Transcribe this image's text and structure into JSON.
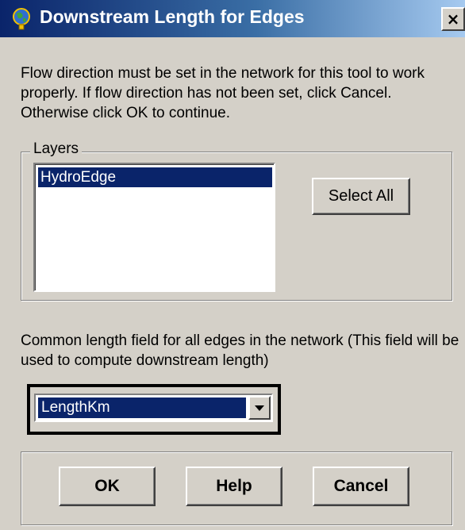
{
  "window": {
    "title": "Downstream Length for Edges",
    "close_glyph": "×"
  },
  "message": "Flow direction must be set in the network for this tool to work properly. If flow direction has not been set, click Cancel. Otherwise click OK to continue.",
  "layers": {
    "label": "Layers",
    "items": [
      "HydroEdge"
    ],
    "select_all_label": "Select All"
  },
  "length_field": {
    "label": "Common length field for all edges in the network (This field will be used to compute downstream length)",
    "selected": "LengthKm"
  },
  "buttons": {
    "ok": "OK",
    "help": "Help",
    "cancel": "Cancel"
  },
  "colors": {
    "title_gradient_start": "#0A246A",
    "selection": "#0A246A",
    "dialog_face": "#D4D0C8"
  }
}
